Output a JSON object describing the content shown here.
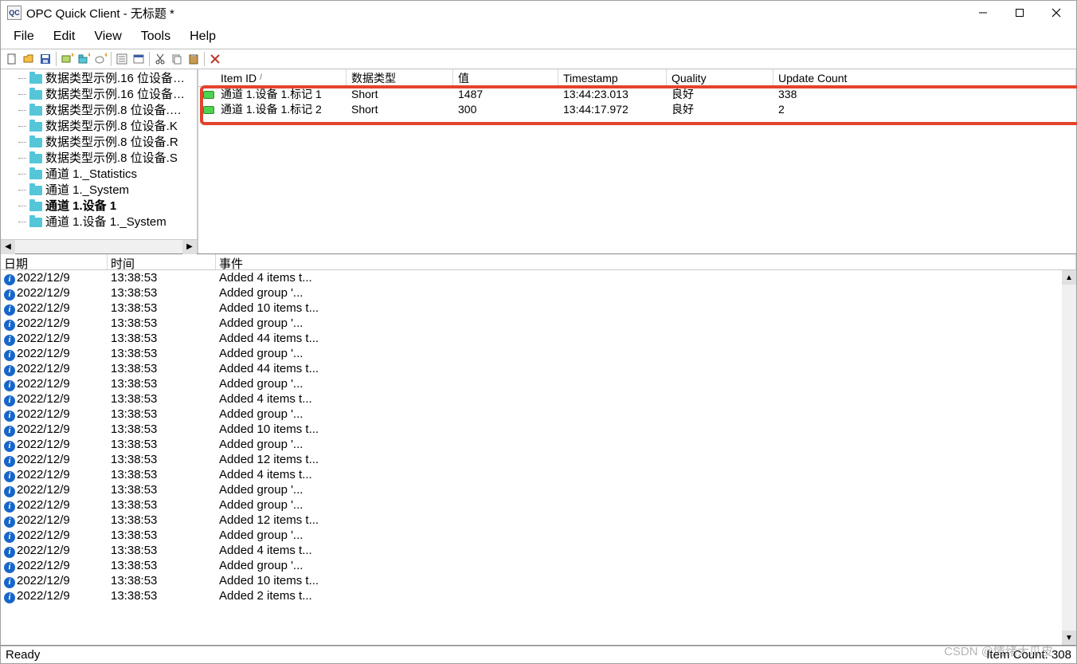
{
  "title": "OPC Quick Client - 无标题 *",
  "menu": {
    "file": "File",
    "edit": "Edit",
    "view": "View",
    "tools": "Tools",
    "help": "Help"
  },
  "tree": [
    {
      "label": "数据类型示例.16 位设备…",
      "bold": false
    },
    {
      "label": "数据类型示例.16 位设备…",
      "bold": false
    },
    {
      "label": "数据类型示例.8 位设备.…",
      "bold": false
    },
    {
      "label": "数据类型示例.8 位设备.K",
      "bold": false
    },
    {
      "label": "数据类型示例.8 位设备.R",
      "bold": false
    },
    {
      "label": "数据类型示例.8 位设备.S",
      "bold": false
    },
    {
      "label": "通道 1._Statistics",
      "bold": false
    },
    {
      "label": "通道 1._System",
      "bold": false
    },
    {
      "label": "通道 1.设备 1",
      "bold": true
    },
    {
      "label": "通道 1.设备 1._System",
      "bold": false
    }
  ],
  "item_columns": {
    "id": "Item ID",
    "type": "数据类型",
    "value": "值",
    "ts": "Timestamp",
    "quality": "Quality",
    "count": "Update Count"
  },
  "items": [
    {
      "id": "通道 1.设备 1.标记 1",
      "type": "Short",
      "value": "1487",
      "ts": "13:44:23.013",
      "quality": "良好",
      "count": "338"
    },
    {
      "id": "通道 1.设备 1.标记 2",
      "type": "Short",
      "value": "300",
      "ts": "13:44:17.972",
      "quality": "良好",
      "count": "2"
    }
  ],
  "log_columns": {
    "date": "日期",
    "time": "时间",
    "event": "事件"
  },
  "log": [
    {
      "date": "2022/12/9",
      "time": "13:38:53",
      "event": "Added 4 items t..."
    },
    {
      "date": "2022/12/9",
      "time": "13:38:53",
      "event": "Added group '..."
    },
    {
      "date": "2022/12/9",
      "time": "13:38:53",
      "event": "Added 10 items t..."
    },
    {
      "date": "2022/12/9",
      "time": "13:38:53",
      "event": "Added group '..."
    },
    {
      "date": "2022/12/9",
      "time": "13:38:53",
      "event": "Added 44 items t..."
    },
    {
      "date": "2022/12/9",
      "time": "13:38:53",
      "event": "Added group '..."
    },
    {
      "date": "2022/12/9",
      "time": "13:38:53",
      "event": "Added 44 items t..."
    },
    {
      "date": "2022/12/9",
      "time": "13:38:53",
      "event": "Added group '..."
    },
    {
      "date": "2022/12/9",
      "time": "13:38:53",
      "event": "Added 4 items t..."
    },
    {
      "date": "2022/12/9",
      "time": "13:38:53",
      "event": "Added group '..."
    },
    {
      "date": "2022/12/9",
      "time": "13:38:53",
      "event": "Added 10 items t..."
    },
    {
      "date": "2022/12/9",
      "time": "13:38:53",
      "event": "Added group '..."
    },
    {
      "date": "2022/12/9",
      "time": "13:38:53",
      "event": "Added 12 items t..."
    },
    {
      "date": "2022/12/9",
      "time": "13:38:53",
      "event": "Added 4 items t..."
    },
    {
      "date": "2022/12/9",
      "time": "13:38:53",
      "event": "Added group '..."
    },
    {
      "date": "2022/12/9",
      "time": "13:38:53",
      "event": "Added group '..."
    },
    {
      "date": "2022/12/9",
      "time": "13:38:53",
      "event": "Added 12 items t..."
    },
    {
      "date": "2022/12/9",
      "time": "13:38:53",
      "event": "Added group '..."
    },
    {
      "date": "2022/12/9",
      "time": "13:38:53",
      "event": "Added 4 items t..."
    },
    {
      "date": "2022/12/9",
      "time": "13:38:53",
      "event": "Added group '..."
    },
    {
      "date": "2022/12/9",
      "time": "13:38:53",
      "event": "Added 10 items t..."
    },
    {
      "date": "2022/12/9",
      "time": "13:38:53",
      "event": "Added 2 items t..."
    }
  ],
  "status": {
    "left": "Ready",
    "right": "Item Count: 308"
  },
  "watermark": "CSDN @情绪大瓜皮"
}
